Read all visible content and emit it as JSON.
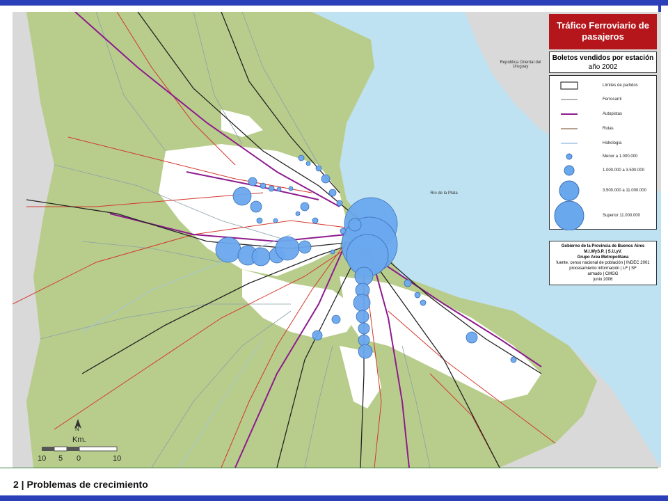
{
  "legend": {
    "title": "Tráfico Ferroviario de pasajeros",
    "subtitle": "Boletos vendidos por estación",
    "year": "año 2002",
    "items": [
      {
        "label": "Límites de partidos",
        "symbol": "box"
      },
      {
        "label": "Ferrocarril",
        "symbol": "line",
        "color": "#999999"
      },
      {
        "label": "Autopistas",
        "symbol": "line",
        "color": "#8e1a8e"
      },
      {
        "label": "Rutas",
        "symbol": "line",
        "color": "#a0806a"
      },
      {
        "label": "Hidrología",
        "symbol": "line",
        "color": "#9ec3e6"
      },
      {
        "label": "Menor a 1.000.000",
        "symbol": "circle"
      },
      {
        "label": "1.000.000 a 3.500.000",
        "symbol": "circle"
      },
      {
        "label": "3.500.000 a 11.000.000",
        "symbol": "circle"
      },
      {
        "label": "Superior 11.000.000",
        "symbol": "circle"
      }
    ],
    "credits": {
      "line1": "Gobierno de la Provincia de Buenos Aires",
      "line2": "M.I.WyS.P. | S.U.yV.",
      "line3": "Grupo Area Metropolitana",
      "line4": "fuente. censo nacional de población | INDEC 2001",
      "line5": "procesamiento información | LF | SF",
      "line6": "armado | CMGG",
      "line7": "junio 2006"
    }
  },
  "map_labels": {
    "uruguay": "República Oriental del Uruguay",
    "river": "Río de la Plata"
  },
  "scale": {
    "north": "N",
    "unit": "Km.",
    "ticks": [
      "10",
      "5",
      "0",
      "10"
    ]
  },
  "footer": {
    "text": "2 | Problemas de crecimiento"
  },
  "colors": {
    "land": "#b8cd8c",
    "water": "#bfe2f3",
    "urban": "#ffffff",
    "highway": "#8e1a8e",
    "route": "#d2372b",
    "railway": "#222222",
    "station": "#6aa8ee",
    "title_bg": "#b5161b",
    "frame": "#2a3fb8"
  }
}
